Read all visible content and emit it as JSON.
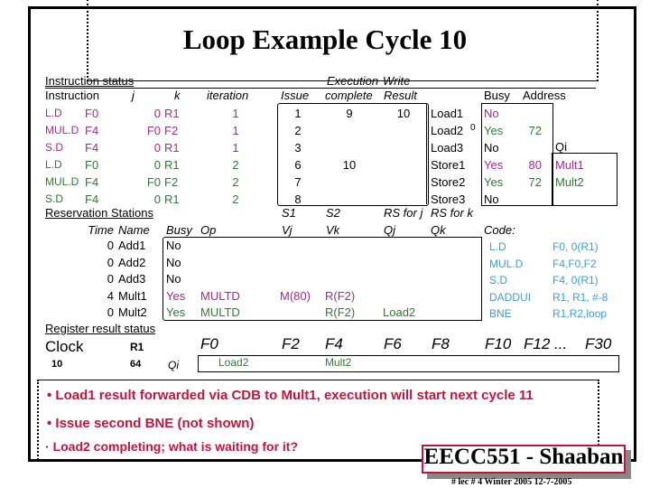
{
  "title": "Loop Example Cycle 10",
  "colors": {
    "iteration1": "#a02c8c",
    "iteration2": "#2f7a34",
    "code": "#3aa0d2",
    "notes": "#c0163e"
  },
  "instruction_status": {
    "section_label": "Instruction status",
    "headers": {
      "instruction": "Instruction",
      "j": "j",
      "k": "k",
      "iteration": "iteration",
      "issue": "Issue",
      "exec_top": "Execution",
      "exec_bottom": "complete",
      "write_top": "Write",
      "write_bottom": "Result"
    },
    "rows": [
      {
        "op": "L.D",
        "dest": "F0",
        "j": "0",
        "k": "R1",
        "iteration": "1",
        "issue": "1",
        "exec": "9",
        "write": "10",
        "color": "iteration1"
      },
      {
        "op": "MUL.D",
        "dest": "F4",
        "j": "F0",
        "k": "F2",
        "iteration": "1",
        "issue": "2",
        "exec": "",
        "write": "",
        "color": "iteration1"
      },
      {
        "op": "S.D",
        "dest": "F4",
        "j": "0",
        "k": "R1",
        "iteration": "1",
        "issue": "3",
        "exec": "",
        "write": "",
        "color": "iteration1"
      },
      {
        "op": "L.D",
        "dest": "F0",
        "j": "0",
        "k": "R1",
        "iteration": "2",
        "issue": "6",
        "exec": "10",
        "write": "",
        "color": "iteration2"
      },
      {
        "op": "MUL.D",
        "dest": "F4",
        "j": "F0",
        "k": "F2",
        "iteration": "2",
        "issue": "7",
        "exec": "",
        "write": "",
        "color": "iteration2"
      },
      {
        "op": "S.D",
        "dest": "F4",
        "j": "0",
        "k": "R1",
        "iteration": "2",
        "issue": "8",
        "exec": "",
        "write": "",
        "color": "iteration2"
      }
    ]
  },
  "load_store_buffers": {
    "headers": {
      "busy": "Busy",
      "address": "Address",
      "qi": "Qi"
    },
    "stray_mark": "0",
    "rows": [
      {
        "name": "Load1",
        "busy": "No",
        "address": "",
        "qi": "",
        "color": "iteration1"
      },
      {
        "name": "Load2",
        "busy": "Yes",
        "address": "72",
        "qi": "",
        "color": "iteration2"
      },
      {
        "name": "Load3",
        "busy": "No",
        "address": "",
        "qi": "",
        "color": ""
      },
      {
        "name": "Store1",
        "busy": "Yes",
        "address": "80",
        "qi": "Mult1",
        "color": "iteration1"
      },
      {
        "name": "Store2",
        "busy": "Yes",
        "address": "72",
        "qi": "Mult2",
        "color": "iteration2"
      },
      {
        "name": "Store3",
        "busy": "No",
        "address": "",
        "qi": "",
        "color": ""
      }
    ]
  },
  "reservation_stations": {
    "section_label": "Reservation Stations",
    "headers": {
      "time": "Time",
      "name": "Name",
      "busy": "Busy",
      "op": "Op",
      "s1": "S1",
      "vj": "Vj",
      "s2": "S2",
      "vk": "Vk",
      "rsj": "RS for j",
      "qj": "Qj",
      "rsk": "RS for k",
      "qk": "Qk"
    },
    "rows": [
      {
        "time": "0",
        "name": "Add1",
        "busy": "No",
        "op": "",
        "vj": "",
        "vk": "",
        "qj": "",
        "qk": "",
        "color": ""
      },
      {
        "time": "0",
        "name": "Add2",
        "busy": "No",
        "op": "",
        "vj": "",
        "vk": "",
        "qj": "",
        "qk": "",
        "color": ""
      },
      {
        "time": "0",
        "name": "Add3",
        "busy": "No",
        "op": "",
        "vj": "",
        "vk": "",
        "qj": "",
        "qk": "",
        "color": ""
      },
      {
        "time": "4",
        "name": "Mult1",
        "busy": "Yes",
        "op": "MULTD",
        "vj": "M(80)",
        "vk": "R(F2)",
        "qj": "",
        "qk": "",
        "color": "iteration1"
      },
      {
        "time": "0",
        "name": "Mult2",
        "busy": "Yes",
        "op": "MULTD",
        "vj": "",
        "vk": "R(F2)",
        "qj": "Load2",
        "qk": "",
        "color": "iteration2"
      }
    ]
  },
  "code": {
    "label": "Code:",
    "lines": [
      {
        "op": "L.D",
        "args": "F0, 0(R1)"
      },
      {
        "op": "MUL.D",
        "args": "F4,F0,F2"
      },
      {
        "op": "S.D",
        "args": "F4, 0(R1)"
      },
      {
        "op": "DADDUI",
        "args": "R1, R1, #-8"
      },
      {
        "op": "BNE",
        "args": "R1,R2,loop"
      }
    ]
  },
  "register_status": {
    "section_label": "Register result status",
    "clock_label": "Clock",
    "clock_value": "10",
    "r1_label": "R1",
    "r1_value": "64",
    "qi_label": "Qi",
    "registers": [
      "F0",
      "F2",
      "F4",
      "F6",
      "F8",
      "F10",
      "F12 ...",
      "F30"
    ],
    "values": {
      "F0": "Load2",
      "F4": "Mult2"
    }
  },
  "notes": [
    "Load1  result forwarded via  CDB  to  Mult1, execution will start next cycle 11",
    "Issue second BNE (not shown)",
    "Load2 completing; what is waiting for it?"
  ],
  "footer": {
    "badge": "EECC551 - Shaaban",
    "caption": "#  lec # 4  Winter 2005     12-7-2005"
  }
}
